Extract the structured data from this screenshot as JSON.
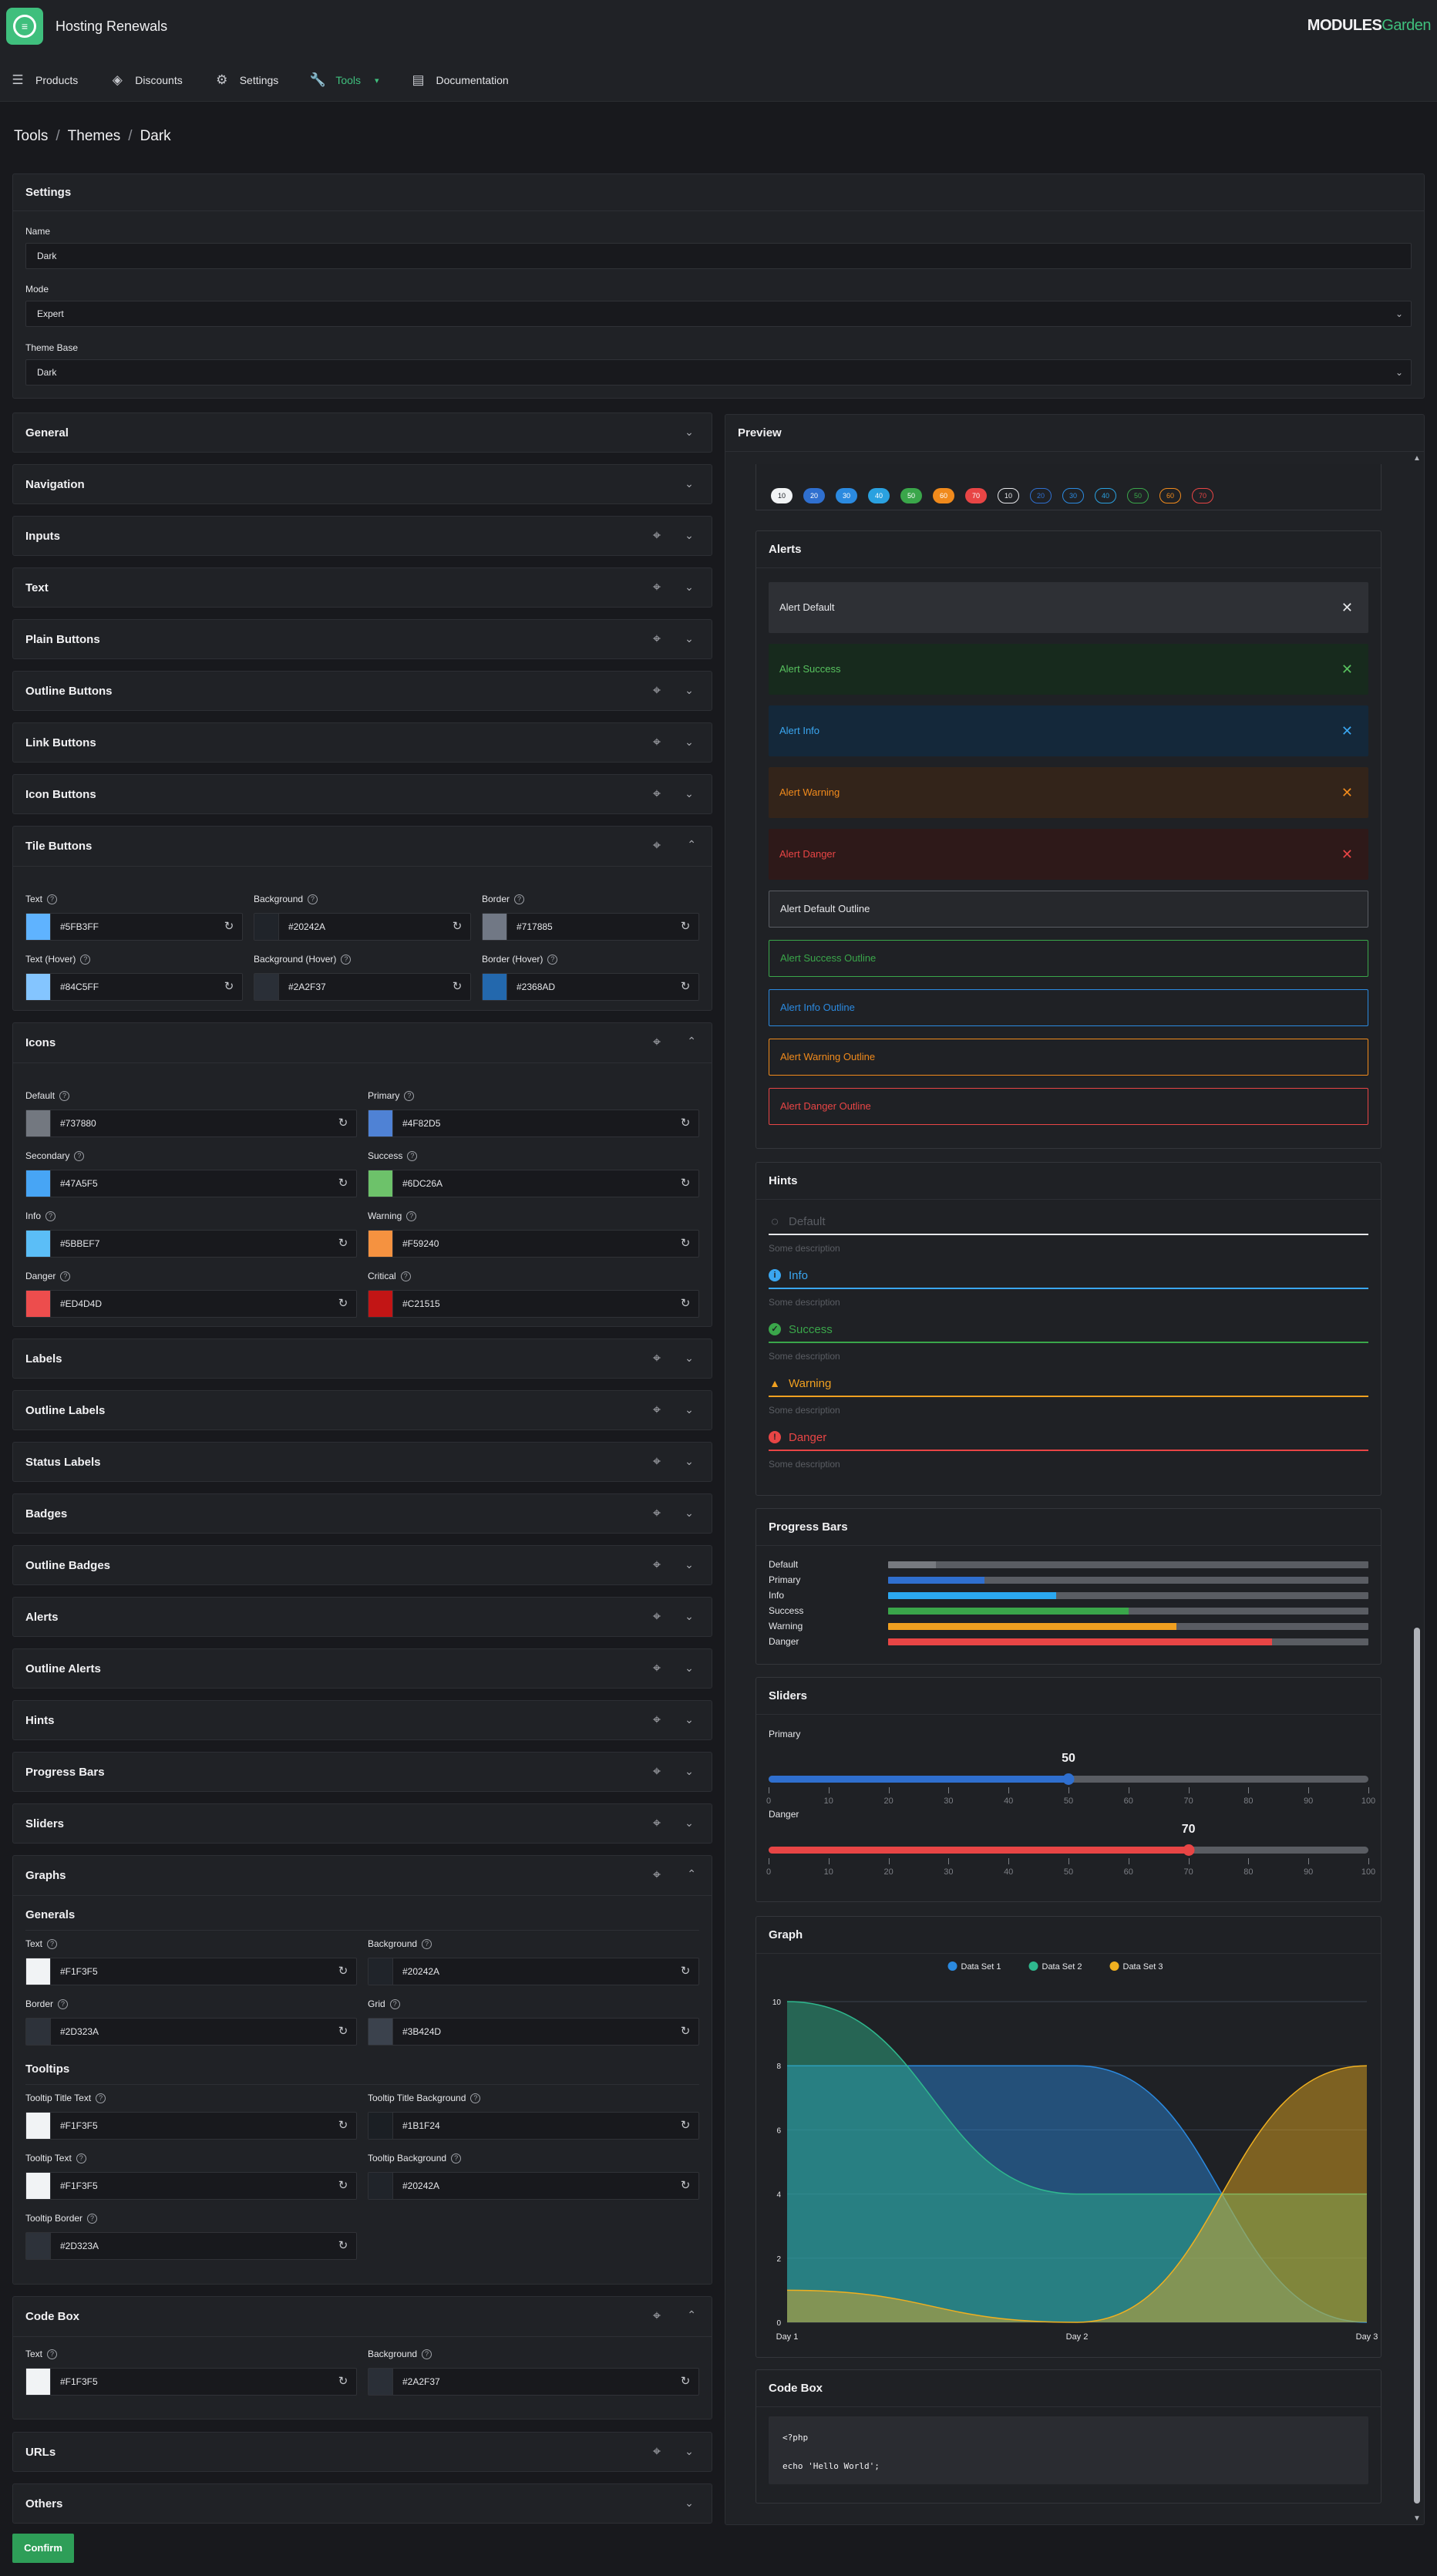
{
  "app": {
    "title": "Hosting Renewals",
    "brand_main": "MODULES",
    "brand_accent": "Garden"
  },
  "nav": [
    {
      "label": "Products",
      "icon": "list-icon"
    },
    {
      "label": "Discounts",
      "icon": "tag-icon"
    },
    {
      "label": "Settings",
      "icon": "gear-icon"
    },
    {
      "label": "Tools",
      "icon": "wrench-icon",
      "active": true
    },
    {
      "label": "Documentation",
      "icon": "document-icon"
    }
  ],
  "breadcrumb": [
    "Tools",
    "Themes",
    "Dark"
  ],
  "settings": {
    "title": "Settings",
    "name_label": "Name",
    "name_value": "Dark",
    "mode_label": "Mode",
    "mode_value": "Expert",
    "base_label": "Theme Base",
    "base_value": "Dark"
  },
  "sections": {
    "general": "General",
    "navigation": "Navigation",
    "inputs": "Inputs",
    "text": "Text",
    "plain_buttons": "Plain Buttons",
    "outline_buttons": "Outline Buttons",
    "link_buttons": "Link Buttons",
    "icon_buttons": "Icon Buttons",
    "tile_buttons": "Tile Buttons",
    "icons": "Icons",
    "labels": "Labels",
    "outline_labels": "Outline Labels",
    "status_labels": "Status Labels",
    "badges": "Badges",
    "outline_badges": "Outline Badges",
    "alerts": "Alerts",
    "outline_alerts": "Outline Alerts",
    "hints": "Hints",
    "progress_bars": "Progress Bars",
    "sliders": "Sliders",
    "graphs": "Graphs",
    "code_box": "Code Box",
    "urls": "URLs",
    "others": "Others"
  },
  "tile_buttons": [
    {
      "label": "Text",
      "hex": "#5FB3FF",
      "color": "#5FB3FF"
    },
    {
      "label": "Background",
      "hex": "#20242A",
      "color": "#20242A"
    },
    {
      "label": "Border",
      "hex": "#717885",
      "color": "#717885"
    },
    {
      "label": "Text (Hover)",
      "hex": "#84C5FF",
      "color": "#84C5FF"
    },
    {
      "label": "Background (Hover)",
      "hex": "#2A2F37",
      "color": "#2A2F37"
    },
    {
      "label": "Border (Hover)",
      "hex": "#2368AD",
      "color": "#2368AD"
    }
  ],
  "icons": [
    {
      "label": "Default",
      "hex": "#737880",
      "color": "#737880"
    },
    {
      "label": "Primary",
      "hex": "#4F82D5",
      "color": "#4F82D5"
    },
    {
      "label": "Secondary",
      "hex": "#47A5F5",
      "color": "#47A5F5"
    },
    {
      "label": "Success",
      "hex": "#6DC26A",
      "color": "#6DC26A"
    },
    {
      "label": "Info",
      "hex": "#5BBEF7",
      "color": "#5BBEF7"
    },
    {
      "label": "Warning",
      "hex": "#F59240",
      "color": "#F59240"
    },
    {
      "label": "Danger",
      "hex": "#ED4D4D",
      "color": "#ED4D4D"
    },
    {
      "label": "Critical",
      "hex": "#C21515",
      "color": "#C21515"
    }
  ],
  "graphs": {
    "generals_title": "Generals",
    "tooltips_title": "Tooltips",
    "generals": [
      {
        "label": "Text",
        "hex": "#F1F3F5",
        "color": "#F1F3F5"
      },
      {
        "label": "Background",
        "hex": "#20242A",
        "color": "#20242A"
      },
      {
        "label": "Border",
        "hex": "#2D323A",
        "color": "#2D323A"
      },
      {
        "label": "Grid",
        "hex": "#3B424D",
        "color": "#3B424D"
      }
    ],
    "tooltips": [
      {
        "label": "Tooltip Title Text",
        "hex": "#F1F3F5",
        "color": "#F1F3F5"
      },
      {
        "label": "Tooltip Title Background",
        "hex": "#1B1F24",
        "color": "#1B1F24"
      },
      {
        "label": "Tooltip Text",
        "hex": "#F1F3F5",
        "color": "#F1F3F5"
      },
      {
        "label": "Tooltip Background",
        "hex": "#20242A",
        "color": "#20242A"
      },
      {
        "label": "Tooltip Border",
        "hex": "#2D323A",
        "color": "#2D323A"
      }
    ]
  },
  "code_box": [
    {
      "label": "Text",
      "hex": "#F1F3F5",
      "color": "#F1F3F5"
    },
    {
      "label": "Background",
      "hex": "#2A2F37",
      "color": "#2A2F37"
    }
  ],
  "confirm_label": "Confirm",
  "preview": {
    "title": "Preview",
    "badges": [
      {
        "text": "10",
        "bg": "#f1f3f5",
        "fg": "#20242a",
        "outline": false
      },
      {
        "text": "20",
        "bg": "#2f6fcf",
        "fg": "#ffffff",
        "outline": false
      },
      {
        "text": "30",
        "bg": "#2b8ae0",
        "fg": "#ffffff",
        "outline": false
      },
      {
        "text": "40",
        "bg": "#2aa1e0",
        "fg": "#ffffff",
        "outline": false
      },
      {
        "text": "50",
        "bg": "#3aa64a",
        "fg": "#ffffff",
        "outline": false
      },
      {
        "text": "60",
        "bg": "#f08a1c",
        "fg": "#ffffff",
        "outline": false
      },
      {
        "text": "70",
        "bg": "#e84545",
        "fg": "#ffffff",
        "outline": false
      },
      {
        "text": "10",
        "bg": "transparent",
        "fg": "#e6e7ea",
        "outline": true,
        "bc": "#e6e7ea"
      },
      {
        "text": "20",
        "bg": "transparent",
        "fg": "#2f6fcf",
        "outline": true,
        "bc": "#2f6fcf"
      },
      {
        "text": "30",
        "bg": "transparent",
        "fg": "#2b8ae0",
        "outline": true,
        "bc": "#2b8ae0"
      },
      {
        "text": "40",
        "bg": "transparent",
        "fg": "#2aa1e0",
        "outline": true,
        "bc": "#2aa1e0"
      },
      {
        "text": "50",
        "bg": "transparent",
        "fg": "#3aa64a",
        "outline": true,
        "bc": "#3aa64a"
      },
      {
        "text": "60",
        "bg": "transparent",
        "fg": "#f08a1c",
        "outline": true,
        "bc": "#f08a1c"
      },
      {
        "text": "70",
        "bg": "transparent",
        "fg": "#e84545",
        "outline": true,
        "bc": "#e84545"
      }
    ],
    "alerts_title": "Alerts",
    "alerts": [
      {
        "text": "Alert Default",
        "bg": "#2e3035",
        "fg": "#e6e7ea",
        "x": "#e6e7ea"
      },
      {
        "text": "Alert Success",
        "bg": "#172a1d",
        "fg": "#57c15e",
        "x": "#57c15e"
      },
      {
        "text": "Alert Info",
        "bg": "#14283a",
        "fg": "#3aa6f0",
        "x": "#3aa6f0"
      },
      {
        "text": "Alert Warning",
        "bg": "#33241a",
        "fg": "#f08a1c",
        "x": "#f08a1c"
      },
      {
        "text": "Alert Danger",
        "bg": "#2e1919",
        "fg": "#e84545",
        "x": "#e84545"
      }
    ],
    "outline_alerts": [
      {
        "text": "Alert Default Outline",
        "bc": "#5a5d63",
        "fg": "#e6e7ea",
        "bg": "#26282c"
      },
      {
        "text": "Alert Success Outline",
        "bc": "#3aa64a",
        "fg": "#3aa64a",
        "bg": "#1f2125"
      },
      {
        "text": "Alert Info Outline",
        "bc": "#2b8ae0",
        "fg": "#2b8ae0",
        "bg": "#1f2125"
      },
      {
        "text": "Alert Warning Outline",
        "bc": "#f08a1c",
        "fg": "#f08a1c",
        "bg": "#1f2125"
      },
      {
        "text": "Alert Danger Outline",
        "bc": "#e84545",
        "fg": "#e84545",
        "bg": "#1f2125"
      }
    ],
    "hints_title": "Hints",
    "hints": [
      {
        "title": "Default",
        "desc": "Some description",
        "color": "#5a5d63",
        "line": "#e6e7ea",
        "icon": "circle-outline-icon",
        "glyph": "○"
      },
      {
        "title": "Info",
        "desc": "Some description",
        "color": "#3aa6f0",
        "line": "#3aa6f0",
        "icon": "info-icon",
        "glyph": "i"
      },
      {
        "title": "Success",
        "desc": "Some description",
        "color": "#3aa64a",
        "line": "#3aa64a",
        "icon": "check-circle-icon",
        "glyph": "✓"
      },
      {
        "title": "Warning",
        "desc": "Some description",
        "color": "#f0a020",
        "line": "#f0a020",
        "icon": "warning-icon",
        "glyph": "!"
      },
      {
        "title": "Danger",
        "desc": "Some description",
        "color": "#e84545",
        "line": "#e84545",
        "icon": "danger-icon",
        "glyph": "!"
      }
    ],
    "progress_title": "Progress Bars",
    "progress": [
      {
        "label": "Default",
        "value": 10,
        "color": "#777a80"
      },
      {
        "label": "Primary",
        "value": 20,
        "color": "#2f6fcf"
      },
      {
        "label": "Info",
        "value": 35,
        "color": "#2ba8f0"
      },
      {
        "label": "Success",
        "value": 50,
        "color": "#3aa64a"
      },
      {
        "label": "Warning",
        "value": 60,
        "color": "#f0a020"
      },
      {
        "label": "Danger",
        "value": 80,
        "color": "#e84545"
      }
    ],
    "sliders_title": "Sliders",
    "sliders": [
      {
        "label": "Primary",
        "value": 50,
        "color": "#2f6fcf"
      },
      {
        "label": "Danger",
        "value": 70,
        "color": "#e84545"
      }
    ],
    "slider_ticks": [
      "0",
      "10",
      "20",
      "30",
      "40",
      "50",
      "60",
      "70",
      "80",
      "90",
      "100"
    ],
    "graph_title": "Graph",
    "codebox_title": "Code Box",
    "code_lines": [
      "<?php",
      "echo 'Hello World';"
    ]
  },
  "chart_data": {
    "type": "area",
    "x": [
      "Day 1",
      "Day 2",
      "Day 3"
    ],
    "ylim": [
      0,
      10
    ],
    "yticks": [
      "0",
      "2",
      "4",
      "6",
      "8",
      "10"
    ],
    "grid": true,
    "legend_position": "top",
    "series": [
      {
        "name": "Data Set 1",
        "values": [
          8,
          8,
          0
        ],
        "color": "#2b8ae0"
      },
      {
        "name": "Data Set 2",
        "values": [
          10,
          4,
          4
        ],
        "color": "#2fb88e"
      },
      {
        "name": "Data Set 3",
        "values": [
          1,
          0,
          8
        ],
        "color": "#f0b020"
      }
    ]
  }
}
